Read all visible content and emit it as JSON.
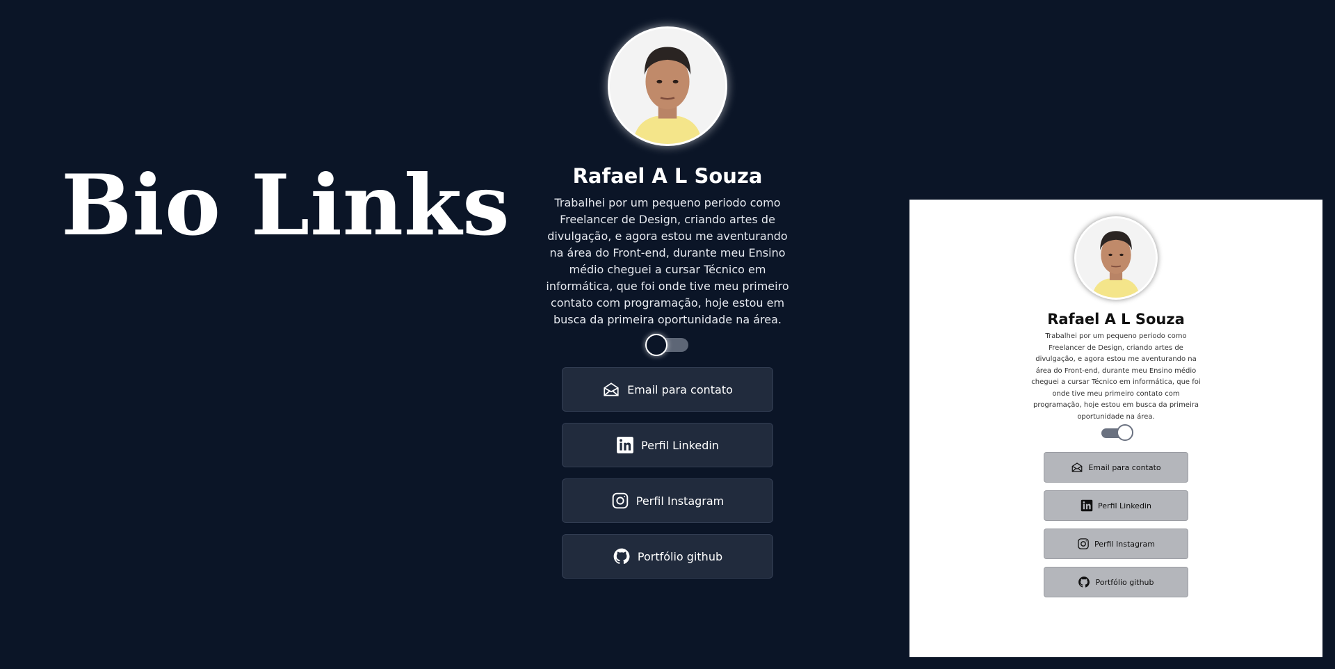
{
  "hero": {
    "title": "Bio Links"
  },
  "profile": {
    "name": "Rafael A L Souza",
    "bio": "Trabalhei por um pequeno periodo como Freelancer de Design, criando artes de divulgação, e agora estou me aventurando na área do Front-end, durante meu Ensino médio cheguei a cursar Técnico em informática, que foi onde tive meu primeiro contato com programação, hoje estou em busca da primeira oportunidade na área."
  },
  "theme": {
    "dark_background": "#0b1527",
    "dark_button": "#212b3d",
    "light_background": "#ffffff",
    "light_button": "#b4b6bb"
  },
  "links": [
    {
      "label": "Email para contato",
      "icon": "envelope-icon"
    },
    {
      "label": "Perfil Linkedin",
      "icon": "linkedin-icon"
    },
    {
      "label": "Perfil Instagram",
      "icon": "instagram-icon"
    },
    {
      "label": "Portfólio github",
      "icon": "github-icon"
    }
  ],
  "preview": {
    "name": "Rafael A L Souza",
    "bio": "Trabalhei por um pequeno periodo como Freelancer de Design, criando artes de divulgação, e agora estou me aventurando na área do Front-end, durante meu Ensino médio cheguei a cursar Técnico em informática, que foi onde tive meu primeiro contato com programação, hoje estou em busca da primeira oportunidade na área."
  }
}
